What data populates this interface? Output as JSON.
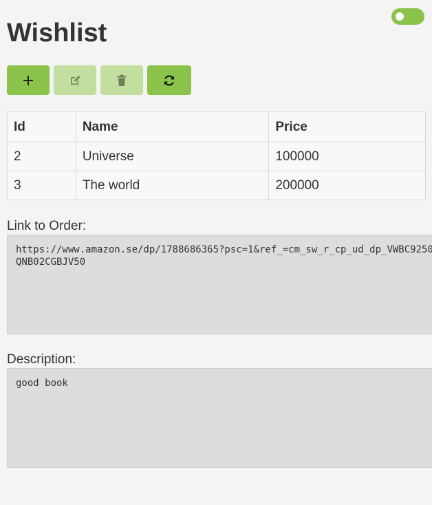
{
  "page": {
    "title": "Wishlist"
  },
  "toggle": {
    "state": "on",
    "color": "#8bc34a"
  },
  "toolbar": {
    "buttons": [
      {
        "icon": "plus-icon",
        "enabled": true
      },
      {
        "icon": "edit-icon",
        "enabled": false
      },
      {
        "icon": "trash-icon",
        "enabled": false
      },
      {
        "icon": "refresh-icon",
        "enabled": true
      }
    ],
    "accent": "#8bc34a",
    "disabled_color": "#c3df9f"
  },
  "table": {
    "headers": [
      "Id",
      "Name",
      "Price"
    ],
    "rows": [
      [
        "2",
        "Universe",
        "100000"
      ],
      [
        "3",
        "The world",
        "200000"
      ]
    ]
  },
  "form": {
    "link_label": "Link to Order:",
    "link_value": "https://www.amazon.se/dp/1788686365?psc=1&ref_=cm_sw_r_cp_ud_dp_VWBC9250QNB02CGBJV50",
    "description_label": "Description:",
    "description_value": "good book"
  }
}
